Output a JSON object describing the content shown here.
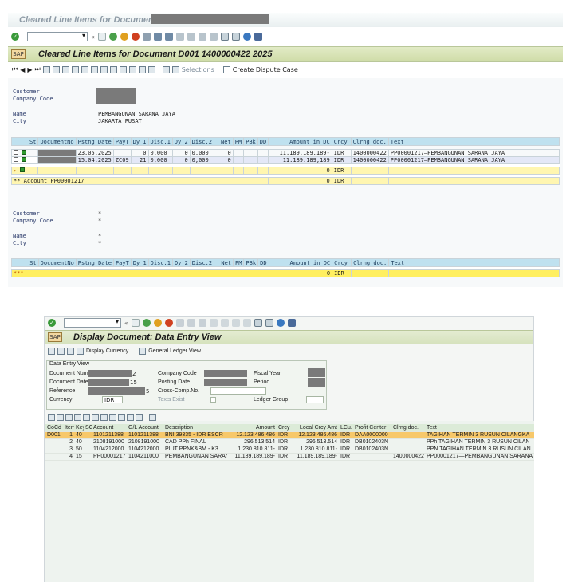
{
  "window1": {
    "title": "Cleared Line Items for Document",
    "screen_title": "Cleared Line Items for Document D001 1400000422 2025",
    "app_toolbar": {
      "selections": "Selections",
      "dispute": "Create Dispute Case"
    },
    "block1": {
      "customer_label": "Customer",
      "company_label": "Company Code",
      "name_label": "Name",
      "name_value": "PEMBANGUNAN SARANA JAYA",
      "city_label": "City",
      "city_value": "JAKARTA PUSAT"
    },
    "columns": [
      "St",
      "DocumentNo",
      "Pstng Date",
      "PayT",
      "Dy 1",
      "Disc.1",
      "Dy 2",
      "Disc.2",
      "Net",
      "PM",
      "PBk",
      "DD",
      "Amount in DC",
      "Crcy",
      "Clrng doc.",
      "Text"
    ],
    "rows": [
      {
        "pstng": "23.05.2025",
        "payt": "",
        "dy1": "0",
        "disc1": "0,000",
        "dy2": "0",
        "disc2": "0,000",
        "net": "0",
        "amount": "11.189.189,189-",
        "crcy": "IDR",
        "clrng": "1400000422",
        "text": "PP00001217—PEMBANGUNAN SARANA JAYA"
      },
      {
        "pstng": "15.04.2025",
        "payt": "ZC09",
        "dy1": "21",
        "disc1": "0,000",
        "dy2": "0",
        "disc2": "0,000",
        "net": "0",
        "amount": "11.189.189,189",
        "crcy": "IDR",
        "clrng": "1400000422",
        "text": "PP00001217—PEMBANGUNAN SARANA JAYA"
      }
    ],
    "subtotal": {
      "amount": "0",
      "crcy": "IDR"
    },
    "account_line": {
      "label": "** Account PP00001217",
      "amount": "0",
      "crcy": "IDR"
    },
    "block2": {
      "customer_label": "Customer",
      "company_label": "Company Code",
      "name_label": "Name",
      "city_label": "City",
      "star": "*"
    },
    "total": {
      "label": "***",
      "amount": "0",
      "crcy": "IDR"
    }
  },
  "window2": {
    "screen_title": "Display Document: Data Entry View",
    "app_toolbar": {
      "display_currency": "Display Currency",
      "gl_view": "General Ledger View"
    },
    "group_title": "Data Entry View",
    "fields": {
      "doc_number_label": "Document Numb",
      "doc_number_suffix": "2",
      "doc_date_label": "Document Date",
      "doc_date_suffix": "15",
      "reference_label": "Reference",
      "reference_suffix": "5",
      "currency_label": "Currency",
      "currency_value": "IDR",
      "company_label": "Company Code",
      "posting_date_label": "Posting Date",
      "cross_comp_label": "Cross-Comp.No.",
      "texts_exist_label": "Texts Exist",
      "fiscal_year_label": "Fiscal Year",
      "period_label": "Period",
      "ledger_group_label": "Ledger Group"
    },
    "columns": [
      "CoCd",
      "Item",
      "Key",
      "SG",
      "Account",
      "G/L Account",
      "Description",
      "Amount",
      "Crcy",
      "Local Crcy Amt",
      "LCu.",
      "Profit Center",
      "Clrng doc.",
      "Text"
    ],
    "rows": [
      {
        "cocd": "D001",
        "item": "1",
        "key": "40",
        "sg": "",
        "account": "1101211388",
        "gl": "1101211388",
        "desc": "BNI 39335 - IDR ESCR",
        "amount": "12.123.486.486",
        "crcy": "IDR",
        "local": "12.123.486.486",
        "lcu": "IDR",
        "pc": "DAA0000000",
        "clrng": "",
        "text": "TAGIHAN TERMIN 3 RUSUN CILANGKA"
      },
      {
        "cocd": "",
        "item": "2",
        "key": "40",
        "sg": "",
        "account": "2108191000",
        "gl": "2108191000",
        "desc": "CAD PPh FINAL",
        "amount": "296.513.514",
        "crcy": "IDR",
        "local": "296.513.514",
        "lcu": "IDR",
        "pc": "DB0102403N",
        "clrng": "",
        "text": "PPh TAGIHAN TERMIN 3 RUSUN CILAN"
      },
      {
        "cocd": "",
        "item": "3",
        "key": "50",
        "sg": "",
        "account": "1104212000",
        "gl": "1104212000",
        "desc": "PIUT PPNK&BM - K3",
        "amount": "1.230.810.811-",
        "crcy": "IDR",
        "local": "1.230.810.811-",
        "lcu": "IDR",
        "pc": "DB0102403N",
        "clrng": "",
        "text": "PPN TAGIHAN TERMIN 3 RUSUN CILAN"
      },
      {
        "cocd": "",
        "item": "4",
        "key": "15",
        "sg": "",
        "account": "PP00001217",
        "gl": "1104211000",
        "desc": "PEMBANGUNAN SARANA J...",
        "amount": "11.189.189.189-",
        "crcy": "IDR",
        "local": "11.189.189.189-",
        "lcu": "IDR",
        "pc": "",
        "clrng": "1400000422",
        "text": "PP00001217—PEMBANGUNAN SARANA"
      }
    ]
  },
  "colors": {
    "header_band": "#d6e2b3",
    "grid_header": "#bfe1ef",
    "subtotal": "#fff6b0",
    "total": "#ffef60",
    "selected_row": "#f7c86a"
  }
}
